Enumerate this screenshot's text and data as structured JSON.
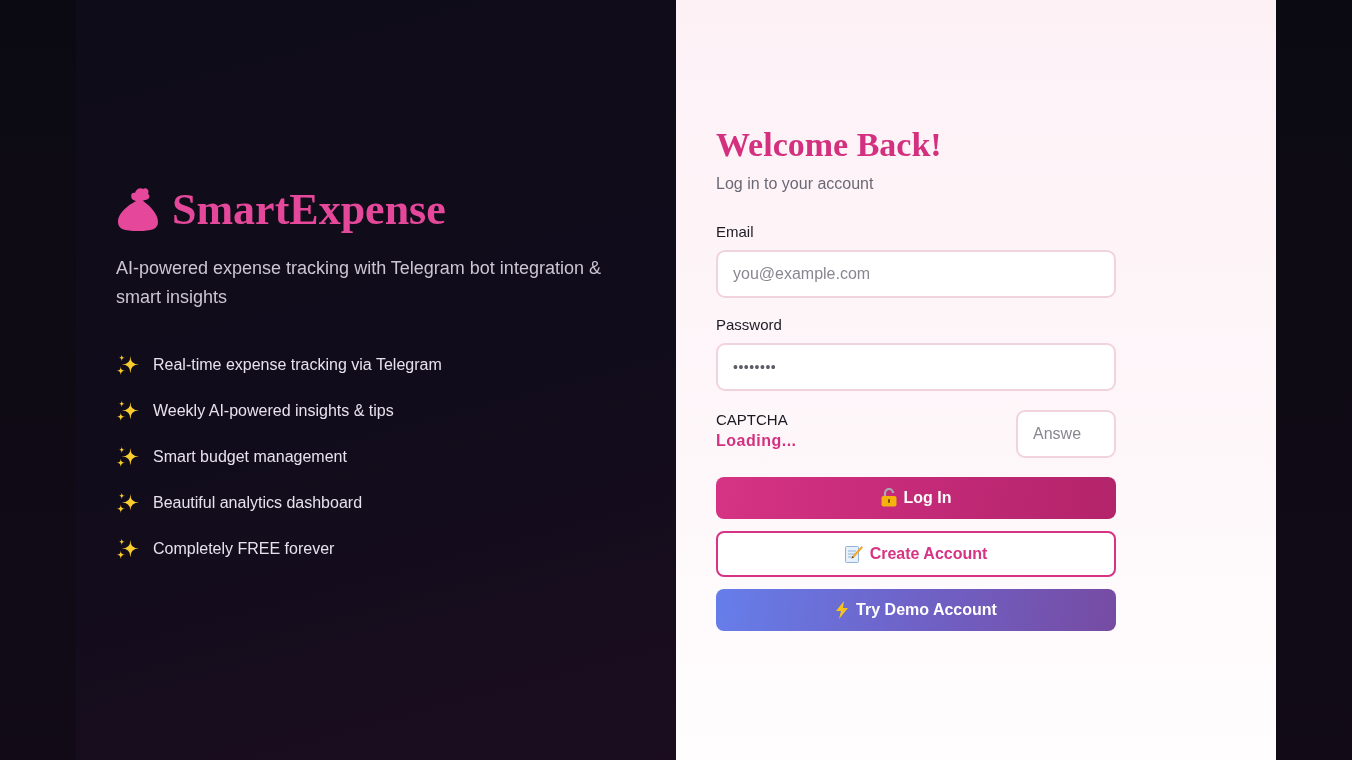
{
  "brand": {
    "name": "SmartExpense",
    "tagline": "AI-powered expense tracking with Telegram bot integration & smart insights",
    "features": [
      "Real-time expense tracking via Telegram",
      "Weekly AI-powered insights & tips",
      "Smart budget management",
      "Beautiful analytics dashboard",
      "Completely FREE forever"
    ]
  },
  "login": {
    "title": "Welcome Back!",
    "subtitle": "Log in to your account",
    "fields": [
      {
        "label": "Email",
        "placeholder": "you@example.com"
      },
      {
        "label": "Password",
        "value": "••••••••"
      }
    ],
    "captcha": {
      "label": "CAPTCHA",
      "status": "Loading...",
      "answer": {
        "placeholder": "Answe"
      }
    },
    "buttons": [
      {
        "label": "Log In",
        "kind": "primary"
      },
      {
        "label": "Create Account",
        "kind": "outline"
      },
      {
        "label": "Try Demo Account",
        "kind": "demo"
      }
    ]
  }
}
